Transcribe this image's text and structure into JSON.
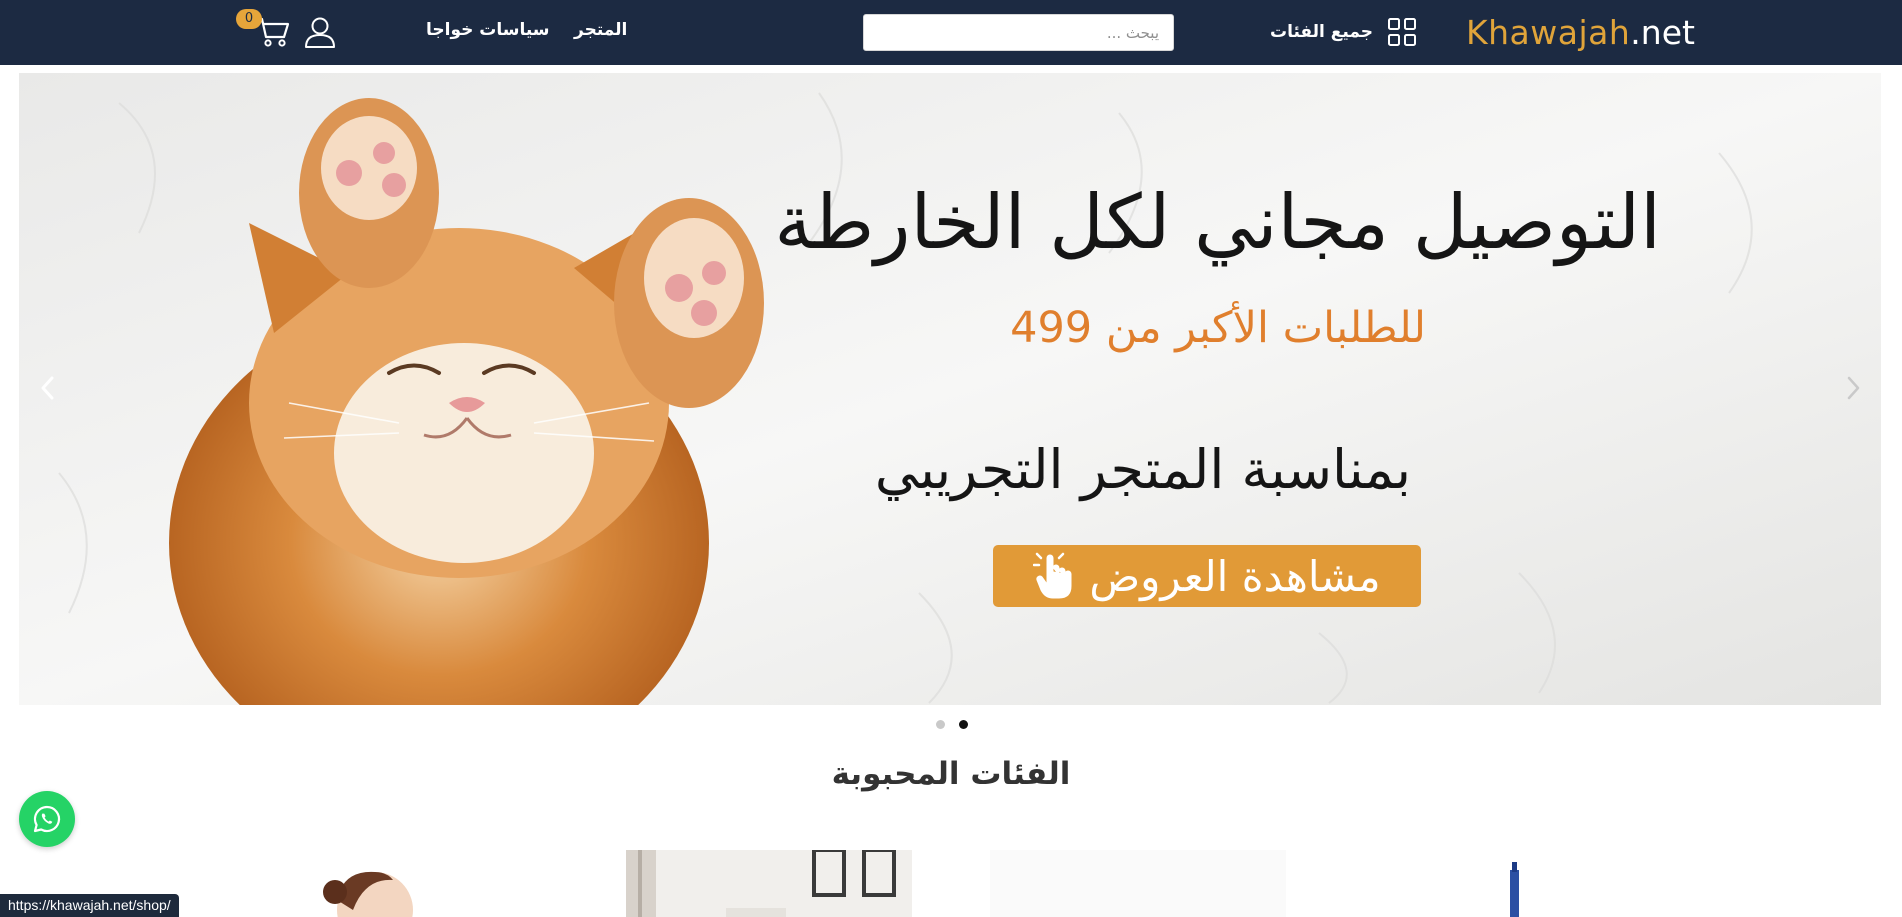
{
  "header": {
    "logo_part1": "Khawajah",
    "logo_part2": ".net",
    "all_categories_label": "جميع الفئات",
    "search_placeholder": "يبحث ...",
    "search_value": "",
    "nav_shop": "المتجر",
    "nav_policies": "سياسات خواجا",
    "cart_count": "0",
    "icons": [
      "grid-icon",
      "search-input",
      "user-icon",
      "cart-icon"
    ]
  },
  "hero": {
    "title": "التوصيل مجاني لكل الخارطة",
    "subtitle": "للطلبات الأكبر من 499",
    "occasion": "بمناسبة المتجر التجريبي",
    "cta_label": "مشاهدة العروض",
    "slides": 2,
    "active_slide": 2
  },
  "sections": {
    "popular_categories_title": "الفئات المحبوبة"
  },
  "status_bar": {
    "url": "https://khawajah.net/shop/"
  },
  "colors": {
    "header_bg": "#1c2a42",
    "accent_orange": "#e19a37",
    "subtitle_orange": "#e07f2d",
    "whatsapp_green": "#25d366"
  }
}
